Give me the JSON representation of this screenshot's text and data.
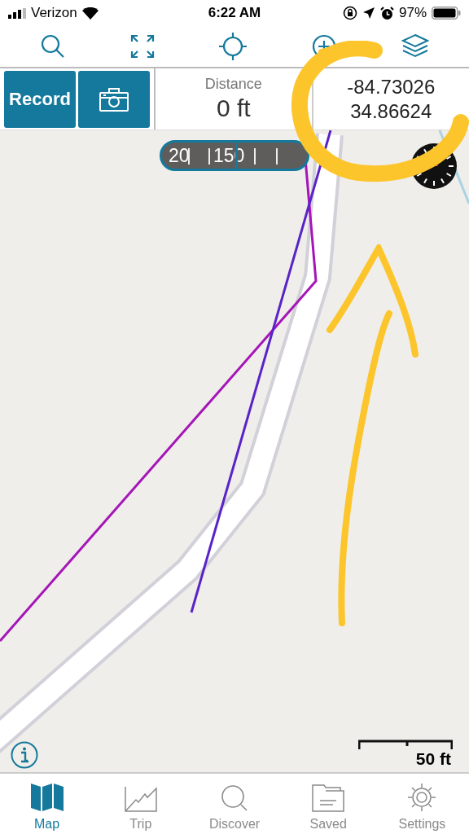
{
  "status_bar": {
    "carrier": "Verizon",
    "time": "6:22 AM",
    "battery": "97%"
  },
  "toolbar": [
    {
      "kind": "search"
    },
    {
      "kind": "expand"
    },
    {
      "kind": "locate"
    },
    {
      "kind": "add"
    },
    {
      "kind": "layers"
    }
  ],
  "record_button": "Record",
  "distance": {
    "label": "Distance",
    "value": "0 ft"
  },
  "coordinates": {
    "longitude": "-84.73026",
    "latitude": "34.86624"
  },
  "scale_tape": {
    "labels": [
      "20",
      "150"
    ]
  },
  "scale_bar": {
    "label": "50 ft"
  },
  "tabs": [
    {
      "label": "Map",
      "kind": "map",
      "selected": true
    },
    {
      "label": "Trip",
      "kind": "trip",
      "selected": false
    },
    {
      "label": "Discover",
      "kind": "discover",
      "selected": false
    },
    {
      "label": "Saved",
      "kind": "saved",
      "selected": false
    },
    {
      "label": "Settings",
      "kind": "settings",
      "selected": false
    }
  ]
}
